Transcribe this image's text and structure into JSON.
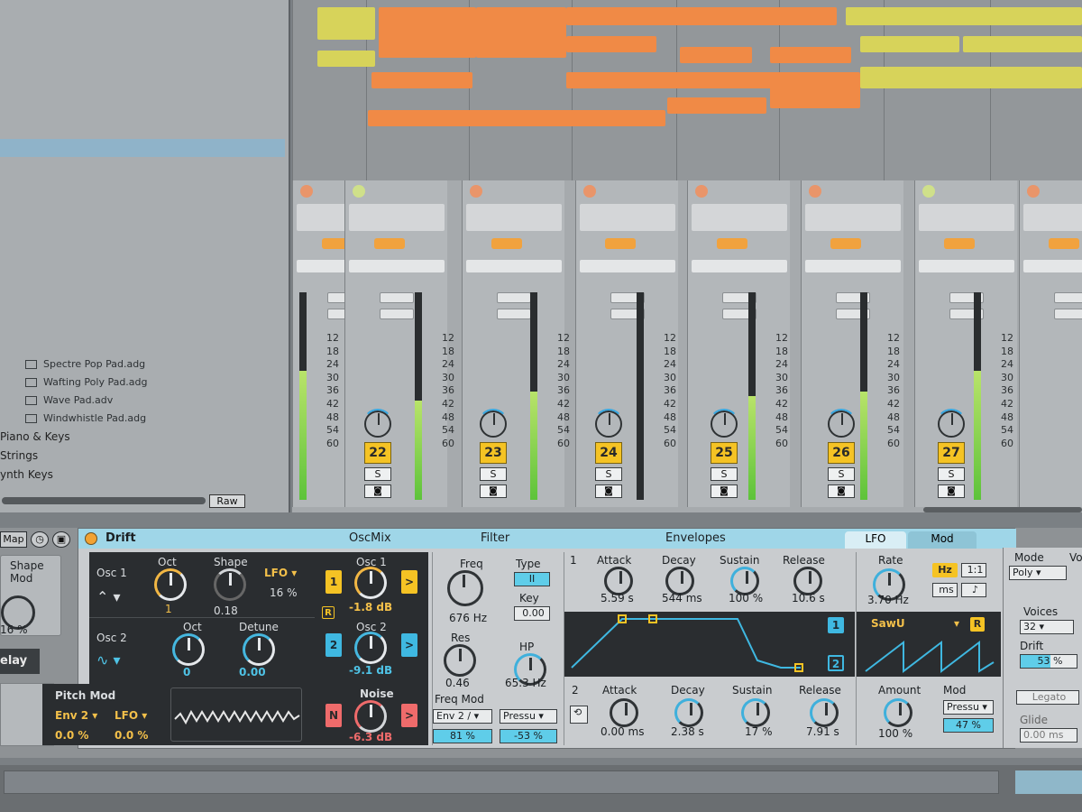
{
  "browser": {
    "items": [
      {
        "label": "",
        "kind": "blurred"
      },
      {
        "label": "",
        "kind": "blurred"
      },
      {
        "label": "",
        "kind": "blurred"
      },
      {
        "label": "",
        "kind": "blurred"
      },
      {
        "label": "",
        "kind": "blurred"
      },
      {
        "label": "",
        "kind": "blurred"
      },
      {
        "label": "",
        "kind": "blurred"
      },
      {
        "label": "",
        "kind": "selected"
      },
      {
        "label": "",
        "kind": "blurred"
      },
      {
        "label": "",
        "kind": "blurred"
      },
      {
        "label": "",
        "kind": "blurred"
      },
      {
        "label": "",
        "kind": "blurred"
      },
      {
        "label": "",
        "kind": "blurred"
      },
      {
        "label": "",
        "kind": "blurred"
      },
      {
        "label": "",
        "kind": "blurred"
      },
      {
        "label": "",
        "kind": "blurred"
      },
      {
        "label": "",
        "kind": "blurred"
      },
      {
        "label": "",
        "kind": "blurred"
      },
      {
        "label": "",
        "kind": "blurred"
      },
      {
        "label": "Spectre Pop Pad.adg",
        "kind": "file"
      },
      {
        "label": "Wafting Poly Pad.adg",
        "kind": "file"
      },
      {
        "label": "Wave Pad.adv",
        "kind": "file"
      },
      {
        "label": "Windwhistle Pad.adg",
        "kind": "file"
      }
    ],
    "categories": [
      "Piano & Keys",
      "Strings",
      "ynth Keys"
    ],
    "raw_label": "Raw"
  },
  "mixer": {
    "tracks": [
      {
        "number": "22",
        "solo": "S",
        "mon": "◙"
      },
      {
        "number": "23",
        "solo": "S",
        "mon": "◙"
      },
      {
        "number": "24",
        "solo": "S",
        "mon": "◙"
      },
      {
        "number": "25",
        "solo": "S",
        "mon": "◙"
      },
      {
        "number": "26",
        "solo": "S",
        "mon": "◙"
      },
      {
        "number": "27",
        "solo": "S",
        "mon": "◙"
      }
    ],
    "scale": [
      "12",
      "18",
      "24",
      "30",
      "36",
      "42",
      "48",
      "54",
      "60"
    ]
  },
  "left_panel": {
    "map_label": "Map",
    "shape_mod_label": "Shape Mod",
    "shape_mod_value": "16 %",
    "delay_label": "elay"
  },
  "drift": {
    "title": "Drift",
    "sections": {
      "oscmix": "OscMix",
      "filter": "Filter",
      "envelopes": "Envelopes"
    },
    "tabs": {
      "lfo": "LFO",
      "mod": "Mod"
    },
    "osc1": {
      "label": "Osc 1",
      "oct_label": "Oct",
      "oct_value": "1",
      "shape_label": "Shape",
      "shape_value": "0.18",
      "lfo_label": "LFO",
      "lfo_value": "16 %"
    },
    "osc2": {
      "label": "Osc 2",
      "oct_label": "Oct",
      "oct_value": "0",
      "detune_label": "Detune",
      "detune_value": "0.00"
    },
    "mix": {
      "osc1_label": "Osc 1",
      "osc1_value": "-1.8 dB",
      "osc1_btn": "1",
      "osc1_arrow": ">",
      "r_label": "R",
      "osc2_label": "Osc 2",
      "osc2_value": "-9.1 dB",
      "osc2_btn": "2",
      "osc2_arrow": ">",
      "noise_label": "Noise",
      "noise_value": "-6.3 dB",
      "noise_btn": "N",
      "noise_arrow": ">"
    },
    "pitch_mod": {
      "label": "Pitch Mod",
      "src1": "Env 2",
      "src2": "LFO",
      "amt1": "0.0 %",
      "amt2": "0.0 %"
    },
    "filter": {
      "freq_label": "Freq",
      "freq_value": "676 Hz",
      "type_label": "Type",
      "type_value": "II",
      "key_label": "Key",
      "key_value": "0.00",
      "res_label": "Res",
      "res_value": "0.46",
      "hp_label": "HP",
      "hp_value": "65.3 Hz",
      "freq_mod_label": "Freq Mod",
      "fm_src1": "Env 2 / ▾",
      "fm_src2": "Pressu ▾",
      "fm_amt1": "81 %",
      "fm_amt2": "-53 %"
    },
    "env1": {
      "index": "1",
      "attack_label": "Attack",
      "attack_value": "5.59 s",
      "decay_label": "Decay",
      "decay_value": "544 ms",
      "sustain_label": "Sustain",
      "sustain_value": "100 %",
      "release_label": "Release",
      "release_value": "10.6 s",
      "btn1": "1",
      "btn2": "2"
    },
    "env2": {
      "index": "2",
      "attack_label": "Attack",
      "attack_value": "0.00 ms",
      "decay_label": "Decay",
      "decay_value": "2.38 s",
      "sustain_label": "Sustain",
      "sustain_value": "17 %",
      "release_label": "Release",
      "release_value": "7.91 s"
    },
    "lfo": {
      "rate_label": "Rate",
      "rate_value": "3.70 Hz",
      "hz_label": "Hz",
      "ratio_label": "1:1",
      "ms_label": "ms",
      "note_label": "♪",
      "wave_label": "SawU",
      "r_label": "R",
      "amount_label": "Amount",
      "amount_value": "100 %",
      "mod_label": "Mod",
      "mod_src": "Pressu ▾",
      "mod_amt": "47 %"
    },
    "global": {
      "mode_label": "Mode",
      "mode_value": "Poly",
      "voices_label": "Voices",
      "voices_value": "32",
      "drift_label": "Drift",
      "drift_value": "53 %",
      "legato_label": "Legato",
      "glide_label": "Glide",
      "glide_value": "0.00 ms",
      "vo_label": "Vo"
    }
  },
  "colors": {
    "accent_yellow": "#f5c324",
    "accent_blue": "#3fb8e1",
    "accent_orange": "#f08a46",
    "meter_green": "#5dc33a"
  }
}
